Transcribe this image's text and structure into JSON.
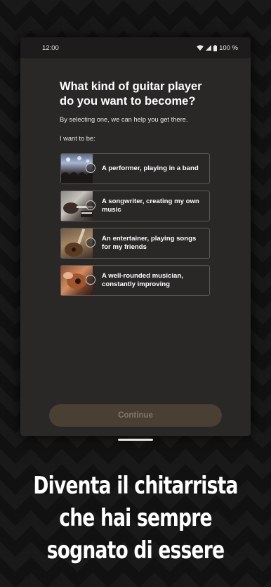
{
  "status_bar": {
    "time": "12:00",
    "battery": "100 %",
    "icons": [
      "wifi-icon",
      "signal-icon",
      "battery-icon"
    ]
  },
  "screen": {
    "title": "What kind of guitar player do you want to become?",
    "subtitle": "By selecting one, we can help you get there.",
    "prompt": "I want to be:",
    "options": [
      {
        "label": "A performer, playing in a band",
        "image": "concert-crowd-photo",
        "selected": false
      },
      {
        "label": "A songwriter, creating my own music",
        "image": "guitar-and-keyboard-photo",
        "selected": false
      },
      {
        "label": "An entertainer, playing songs for my friends",
        "image": "guitar-player-photo",
        "selected": false
      },
      {
        "label": "A well-rounded musician, constantly improving",
        "image": "hands-on-guitar-photo",
        "selected": false
      }
    ],
    "continue_label": "Continue"
  },
  "tagline": {
    "lines": [
      "Diventa il chitarrista",
      "che hai sempre",
      "sognato di essere"
    ]
  },
  "colors": {
    "screen_bg": "#2a2727",
    "button_bg": "#4a3f33",
    "button_text": "#85786a",
    "page_bg": "#101010"
  }
}
